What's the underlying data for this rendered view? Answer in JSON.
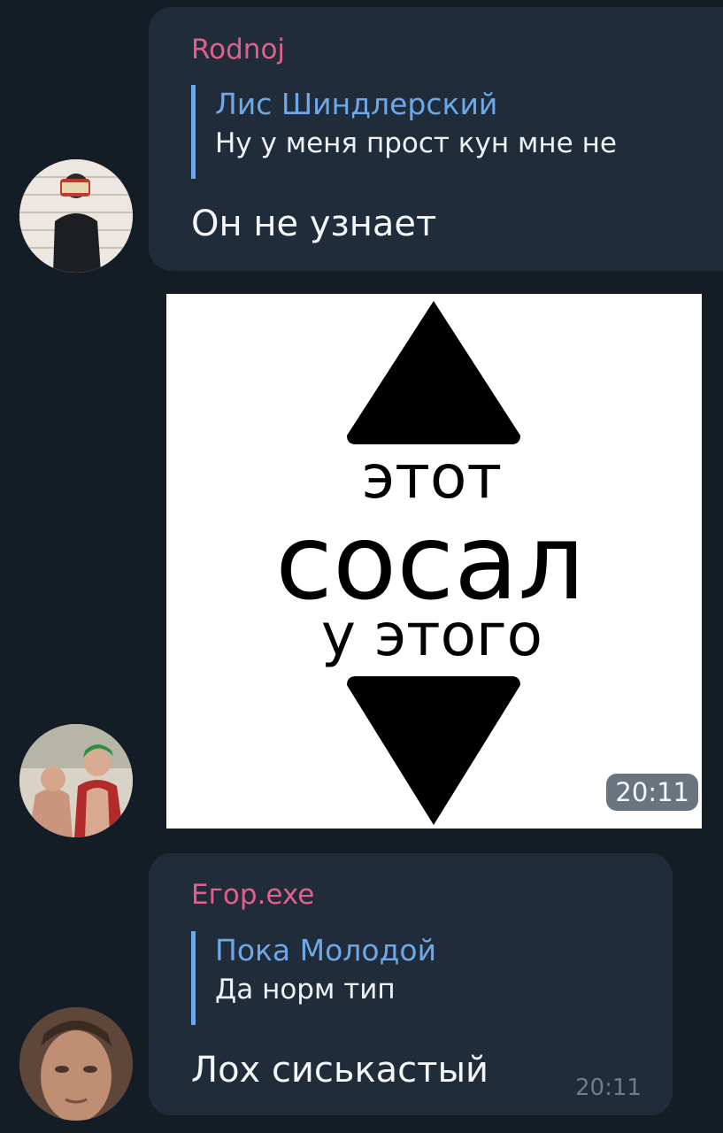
{
  "messages": [
    {
      "sender": "Rodnoj",
      "reply": {
        "name": "Лис Шиндлерский",
        "text": "Ну у меня прост кун мне не"
      },
      "text": "Он не узнает"
    },
    {
      "sticker": {
        "line1": "этот",
        "line2": "сосал",
        "line3": "у этого",
        "time": "20:11"
      }
    },
    {
      "sender": "Егор.exe",
      "reply": {
        "name": "Пока Молодой",
        "text": "Да норм тип"
      },
      "text": "Лох сиськастый",
      "time": "20:11"
    }
  ],
  "colors": {
    "background": "#141c26",
    "bubble": "#202c39",
    "sender": "#e0608c",
    "reply_accent": "#6fa8e8",
    "timestamp": "#6d7c8c"
  }
}
